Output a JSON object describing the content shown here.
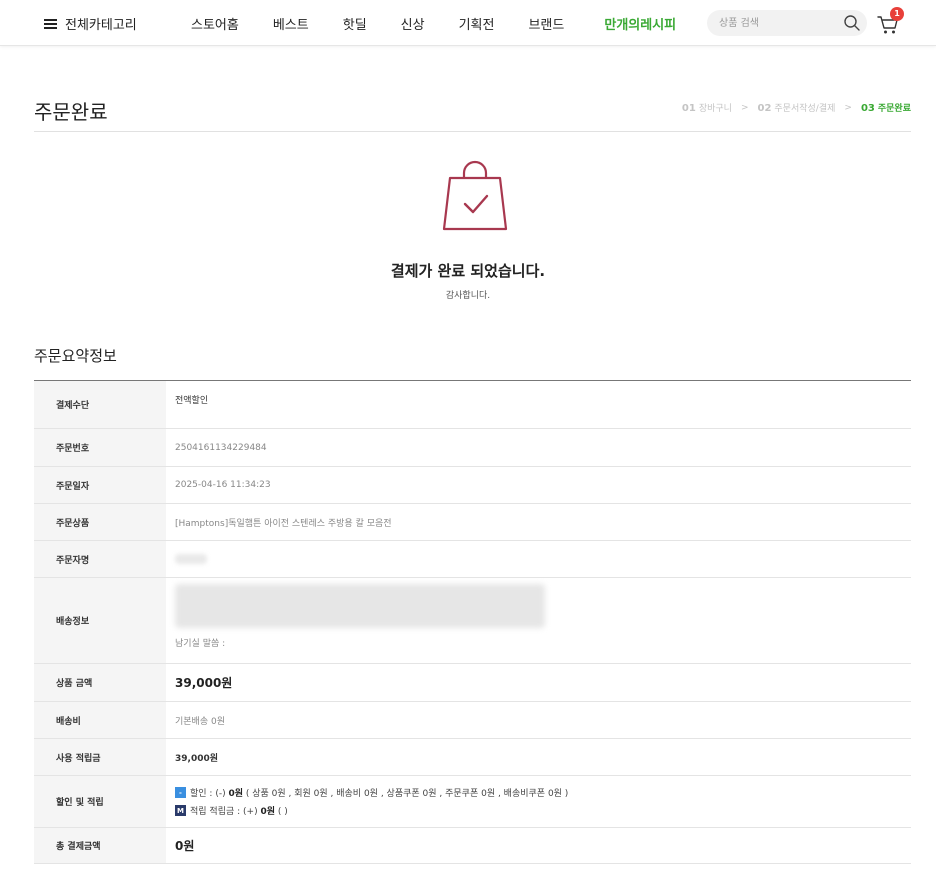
{
  "header": {
    "category_label": "전체카테고리",
    "nav": [
      "스토어홈",
      "베스트",
      "핫딜",
      "신상",
      "기획전",
      "브랜드"
    ],
    "brand_label": "만개의레시피",
    "search_placeholder": "상품 검색",
    "cart_count": "1"
  },
  "page": {
    "title": "주문완료",
    "steps": [
      {
        "num": "01",
        "label": "장바구니"
      },
      {
        "num": "02",
        "label": "주문서작성/결제"
      },
      {
        "num": "03",
        "label": "주문완료"
      }
    ],
    "step_separator": ">"
  },
  "complete": {
    "message": "결제가 완료 되었습니다.",
    "thanks": "감사합니다."
  },
  "summary": {
    "title": "주문요약정보",
    "rows": {
      "payment_method": {
        "label": "결제수단",
        "value": "전액할인"
      },
      "order_number": {
        "label": "주문번호",
        "value": "2504161134229484"
      },
      "order_date": {
        "label": "주문일자",
        "value": "2025-04-16 11:34:23"
      },
      "order_product": {
        "label": "주문상품",
        "value": "[Hamptons]독일햄튼 아이전 스텐레스 주방용 칼 모음전"
      },
      "orderer": {
        "label": "주문자명"
      },
      "shipping": {
        "label": "배송정보",
        "memo": "남기실 말씀 :"
      },
      "product_amount": {
        "label": "상품 금액",
        "value": "39,000원"
      },
      "shipping_fee": {
        "label": "배송비",
        "value": "기본배송 0원"
      },
      "points_used": {
        "label": "사용 적립금",
        "value": "39,000원"
      },
      "discount": {
        "label": "할인 및 적립",
        "discount_tag": "-",
        "discount_prefix": "할인 : (-) ",
        "discount_amount": "0원",
        "discount_detail": " ( 상품 0원 , 회원 0원 , 배송비 0원 , 상품쿠폰 0원 , 주문쿠폰 0원 , 배송비쿠폰 0원 )",
        "points_tag": "M",
        "points_prefix": "적립 적립금 : (+) ",
        "points_amount": "0원",
        "points_detail": " ( )"
      },
      "total": {
        "label": "총 결제금액",
        "value": "0원"
      }
    }
  },
  "colors": {
    "accent_green": "#3aa934",
    "bag_icon": "#a8384f",
    "badge_red": "#e8403a"
  }
}
